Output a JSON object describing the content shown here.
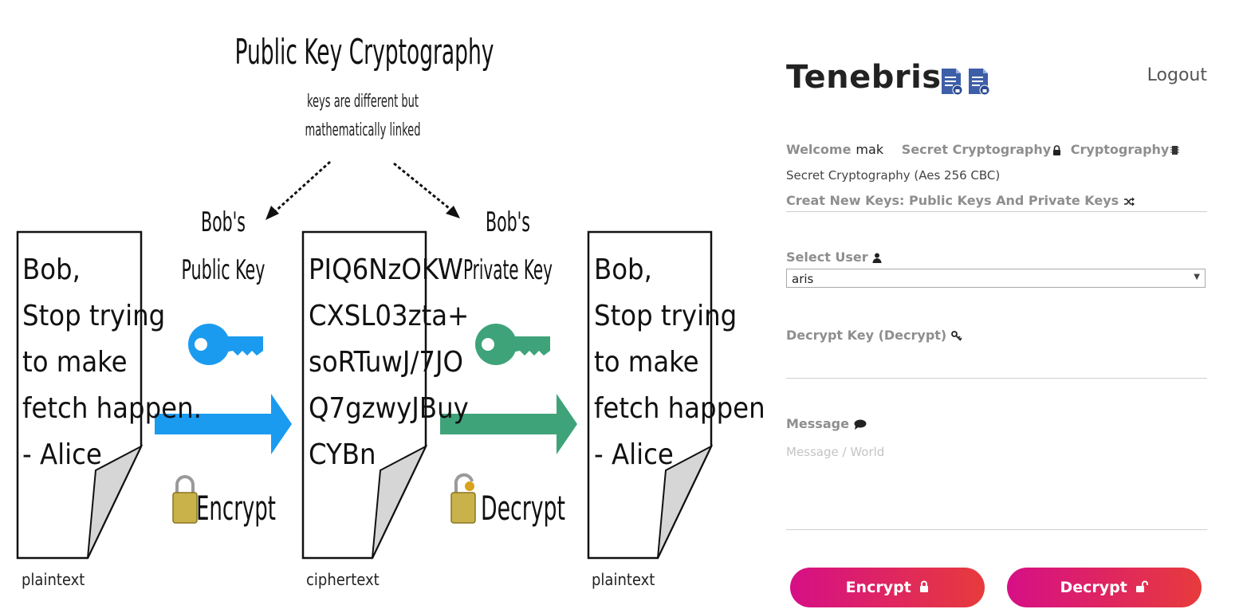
{
  "diagram": {
    "title": "Public Key Cryptography",
    "subtitle_line1": "keys are different but",
    "subtitle_line2": "mathematically linked",
    "public_key_label_1": "Bob's",
    "public_key_label_2": "Public Key",
    "private_key_label_1": "Bob's",
    "private_key_label_2": "Private Key",
    "plaintext_lines": [
      "Bob,",
      "Stop trying",
      "to make",
      "fetch happen.",
      "- Alice"
    ],
    "ciphertext_lines": [
      "PIQ6NzOKW",
      "CXSL03zta+",
      "soRTuwJ/7JO",
      "Q7gzwyJBuy",
      "CYBn"
    ],
    "plaintext_caption": "plaintext",
    "ciphertext_caption": "ciphertext",
    "encrypt_label": "Encrypt",
    "decrypt_label": "Decrypt",
    "colors": {
      "public_key": "#1a9bf0",
      "private_key": "#3fa37a"
    }
  },
  "header": {
    "brand": "Tenebris",
    "logout": "Logout"
  },
  "nav": {
    "welcome": "Welcome",
    "username": "mak",
    "secret_crypto": "Secret Cryptography",
    "crypto": "Cryptography"
  },
  "info": "Secret Cryptography (Aes 256 CBC)",
  "new_keys": "Creat New Keys: Public Keys And Private Keys",
  "form": {
    "select_user_label": "Select User",
    "selected_user": "aris",
    "decrypt_key_label": "Decrypt Key (Decrypt)",
    "message_label": "Message",
    "message_placeholder": "Message / World"
  },
  "buttons": {
    "encrypt": "Encrypt",
    "decrypt": "Decrypt",
    "gradient_start": "#d60f86",
    "gradient_end": "#e73b3c"
  }
}
